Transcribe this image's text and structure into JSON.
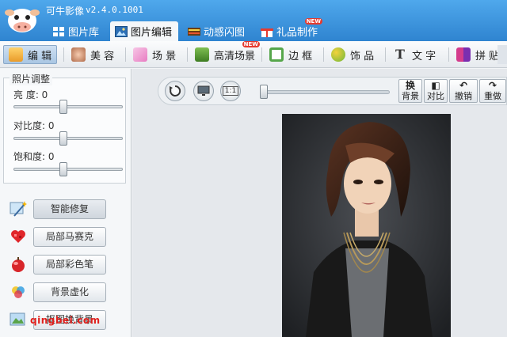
{
  "window": {
    "title": "可牛影像",
    "version": "v2.4.0.1001"
  },
  "main_tabs": [
    {
      "label": "图片库",
      "icon": "gallery-icon",
      "active": false
    },
    {
      "label": "图片编辑",
      "icon": "photo-edit-icon",
      "active": true
    },
    {
      "label": "动感闪图",
      "icon": "film-icon",
      "active": false
    },
    {
      "label": "礼品制作",
      "icon": "gift-icon",
      "active": false,
      "badge": "NEW"
    }
  ],
  "toolbar": {
    "items": [
      {
        "label": "编 辑",
        "icon": "edit-icon",
        "active": true
      },
      {
        "label": "美 容",
        "icon": "beauty-icon"
      },
      {
        "label": "场 景",
        "icon": "scene-icon"
      },
      {
        "label": "高清场景",
        "icon": "hd-scene-icon",
        "badge": "NEW"
      },
      {
        "label": "边 框",
        "icon": "frame-icon"
      },
      {
        "label": "饰 品",
        "icon": "accessory-icon"
      },
      {
        "label": "文 字",
        "icon": "text-icon"
      },
      {
        "label": "拼 贴",
        "icon": "collage-icon"
      }
    ]
  },
  "photo_adjust": {
    "legend": "照片调整",
    "sliders": [
      {
        "label": "亮  度: 0",
        "value": 0
      },
      {
        "label": "对比度: 0",
        "value": 0
      },
      {
        "label": "饱和度: 0",
        "value": 0
      }
    ]
  },
  "functions": [
    {
      "label": "智能修复",
      "icon": "magic-wand-icon"
    },
    {
      "label": "局部马赛克",
      "icon": "mosaic-icon"
    },
    {
      "label": "局部彩色笔",
      "icon": "color-pen-icon"
    },
    {
      "label": "背景虚化",
      "icon": "blur-icon"
    },
    {
      "label": "抠图换背景",
      "icon": "cutout-icon"
    }
  ],
  "watermark": "qingbei.com",
  "subbar": {
    "rotate_icon": "rotate-icon",
    "fit_icon": "monitor-icon",
    "actual_size_label": "1:1",
    "zoom_level": 0,
    "buttons": [
      {
        "label_top": "换",
        "label_bottom": "背景"
      },
      {
        "label_top": "◧",
        "label_bottom": "对比"
      },
      {
        "label_top": "↶",
        "label_bottom": "撤销"
      },
      {
        "label_top": "↷",
        "label_bottom": "重做"
      }
    ]
  },
  "colors": {
    "titlebar": "#3a93de",
    "accent_red": "#e0201c"
  }
}
